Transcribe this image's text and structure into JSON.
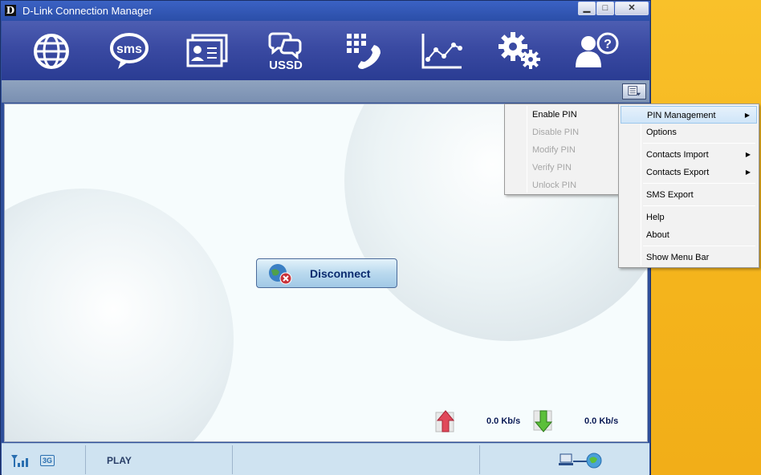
{
  "window": {
    "title": "D-Link Connection Manager",
    "logo_letter": "D"
  },
  "title_buttons": {
    "minimize": "▁",
    "maximize": "□",
    "close": "✕"
  },
  "toolbar": {
    "items": [
      {
        "icon": "globe-icon"
      },
      {
        "icon": "sms-icon",
        "label": "sms"
      },
      {
        "icon": "contacts-card-icon"
      },
      {
        "icon": "ussd-icon",
        "label": "USSD"
      },
      {
        "icon": "phone-keypad-icon"
      },
      {
        "icon": "statistics-chart-icon"
      },
      {
        "icon": "settings-gears-icon"
      },
      {
        "icon": "help-user-icon",
        "label": "?"
      }
    ]
  },
  "main": {
    "disconnect_label": "Disconnect",
    "upload_rate": "0.0 Kb/s",
    "download_rate": "0.0 Kb/s"
  },
  "status": {
    "network_type": "3G",
    "operator": "PLAY"
  },
  "menu_main": {
    "items": [
      {
        "label": "PIN Management",
        "submenu": true,
        "highlighted": true
      },
      {
        "label": "Options"
      },
      {
        "label": "Contacts Import",
        "submenu": true
      },
      {
        "label": "Contacts Export",
        "submenu": true
      },
      {
        "label": "SMS Export"
      },
      {
        "label": "Help"
      },
      {
        "label": "About"
      },
      {
        "label": "Show Menu Bar"
      }
    ]
  },
  "menu_sub": {
    "items": [
      {
        "label": "Enable PIN",
        "enabled": true
      },
      {
        "label": "Disable PIN",
        "enabled": false
      },
      {
        "label": "Modify PIN",
        "enabled": false
      },
      {
        "label": "Verify PIN",
        "enabled": false
      },
      {
        "label": "Unlock PIN",
        "enabled": false
      }
    ]
  },
  "colors": {
    "accent": "#2a3c93",
    "menu_highlight": "#cfe5f8",
    "disabled_text": "#a6a6a6"
  }
}
